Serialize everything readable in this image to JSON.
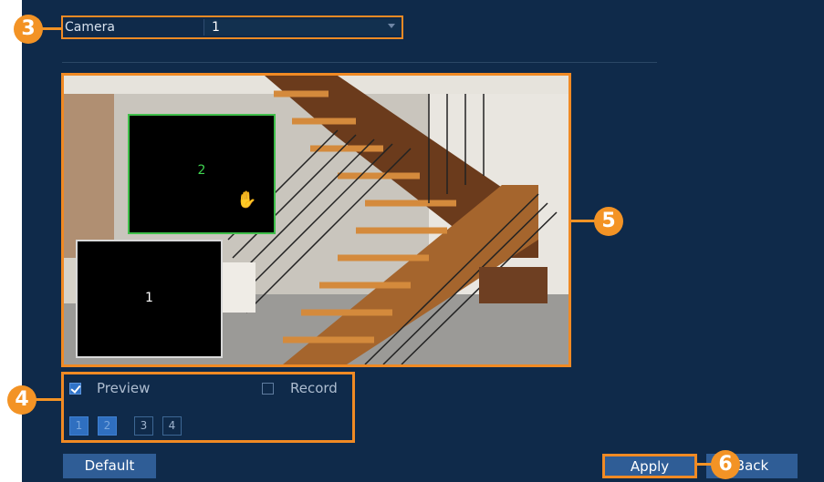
{
  "camera": {
    "label": "Camera",
    "selected": "1"
  },
  "regions": [
    {
      "number": "1",
      "color": "#d9d9d9"
    },
    {
      "number": "2",
      "color": "#3fbf4a"
    }
  ],
  "options": {
    "preview": {
      "label": "Preview",
      "checked": true
    },
    "record": {
      "label": "Record",
      "checked": false
    },
    "region_buttons": [
      {
        "label": "1",
        "active": true
      },
      {
        "label": "2",
        "active": true
      },
      {
        "label": "3",
        "active": false
      },
      {
        "label": "4",
        "active": false
      }
    ]
  },
  "buttons": {
    "default": "Default",
    "apply": "Apply",
    "back": "Back"
  },
  "callouts": [
    "3",
    "4",
    "5",
    "6"
  ],
  "colors": {
    "background": "#0f2a4a",
    "accent": "#f08a24",
    "button": "#2f5d96",
    "active_region": "#3fbf4a"
  }
}
